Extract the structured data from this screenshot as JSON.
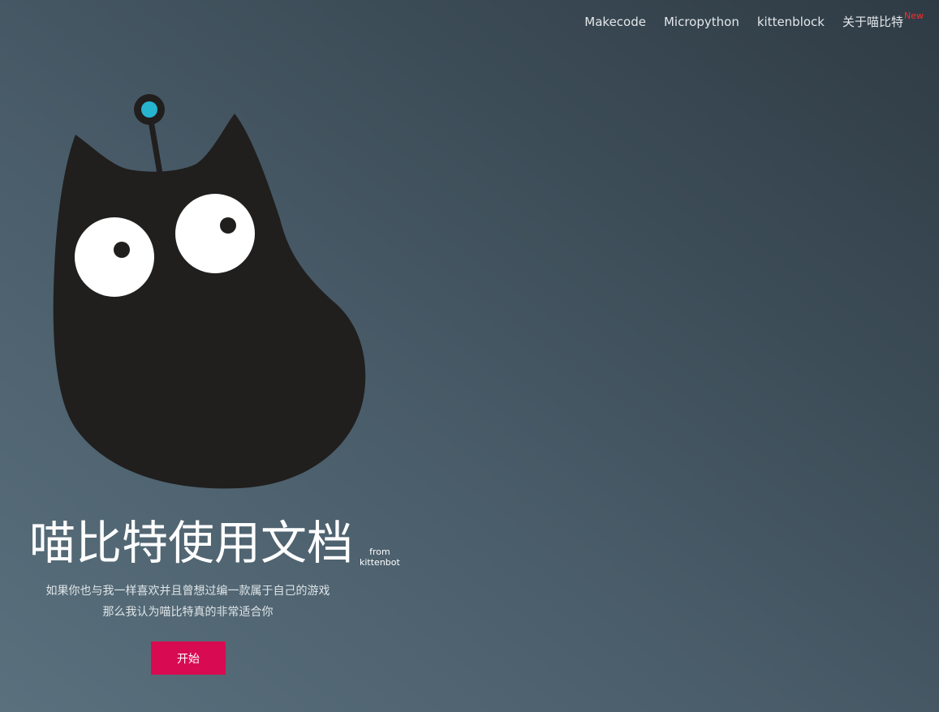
{
  "nav": {
    "items": [
      {
        "label": "Makecode"
      },
      {
        "label": "Micropython"
      },
      {
        "label": "kittenblock"
      },
      {
        "label": "关于喵比特",
        "badge": "New"
      }
    ],
    "badge_color": "#ff2a2a"
  },
  "hero": {
    "title": "喵比特使用文档",
    "from_line1": "from",
    "from_line2": "kittenbot",
    "subtitle_line1": "如果你也与我一样喜欢并且曾想过编一款属于自己的游戏",
    "subtitle_line2": "那么我认为喵比特真的非常适合你",
    "start_label": "开始"
  },
  "colors": {
    "accent": "#d80b52",
    "logo_body": "#201f1e",
    "antenna_tip": "#27b4cf"
  },
  "logo": {
    "icon": "kitten-robot-logo-icon"
  }
}
